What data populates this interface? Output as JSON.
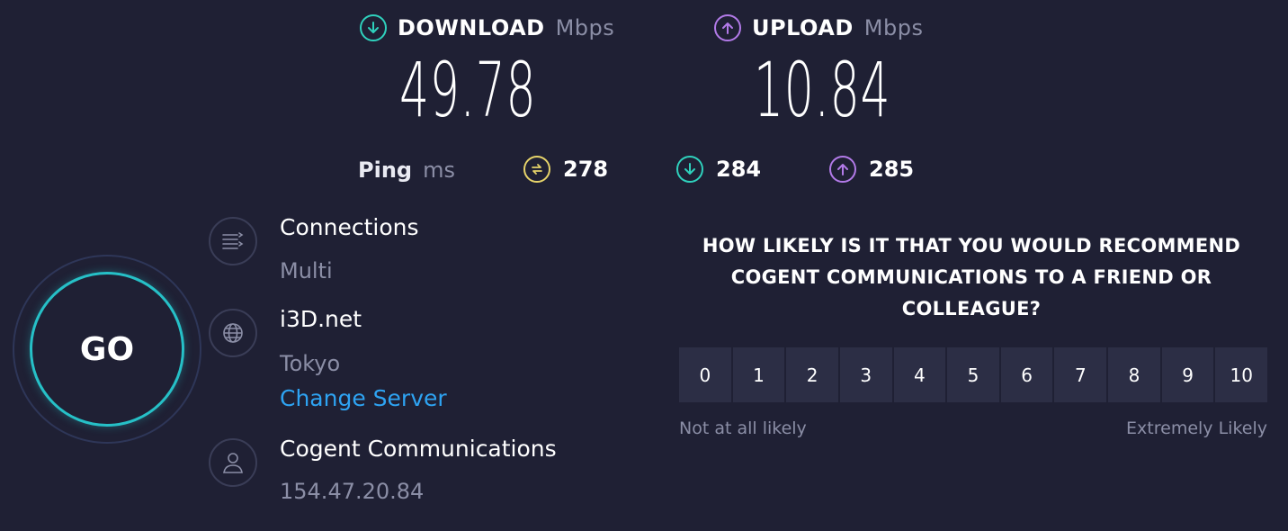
{
  "download": {
    "label": "DOWNLOAD",
    "unit": "Mbps",
    "value": "49.78",
    "icon": "download-arrow-icon",
    "color": "#2fd1bd"
  },
  "upload": {
    "label": "UPLOAD",
    "unit": "Mbps",
    "value": "10.84",
    "icon": "upload-arrow-icon",
    "color": "#b27ae8"
  },
  "ping": {
    "label": "Ping",
    "unit": "ms",
    "idle": {
      "value": "278",
      "icon": "idle-ping-icon",
      "color": "#e6d36a"
    },
    "down": {
      "value": "284",
      "icon": "download-ping-icon",
      "color": "#2fd1bd"
    },
    "up": {
      "value": "285",
      "icon": "upload-ping-icon",
      "color": "#b27ae8"
    }
  },
  "go_button": {
    "label": "GO",
    "color": "#26c0c7"
  },
  "connections": {
    "title": "Connections",
    "value": "Multi",
    "icon": "connections-icon"
  },
  "server": {
    "name": "i3D.net",
    "location": "Tokyo",
    "change_label": "Change Server",
    "icon": "globe-icon"
  },
  "provider": {
    "name": "Cogent Communications",
    "ip": "154.47.20.84",
    "icon": "user-icon"
  },
  "survey": {
    "question": "HOW LIKELY IS IT THAT YOU WOULD RECOMMEND COGENT COMMUNICATIONS TO A FRIEND OR COLLEAGUE?",
    "options": [
      "0",
      "1",
      "2",
      "3",
      "4",
      "5",
      "6",
      "7",
      "8",
      "9",
      "10"
    ],
    "low_label": "Not at all likely",
    "high_label": "Extremely Likely"
  }
}
